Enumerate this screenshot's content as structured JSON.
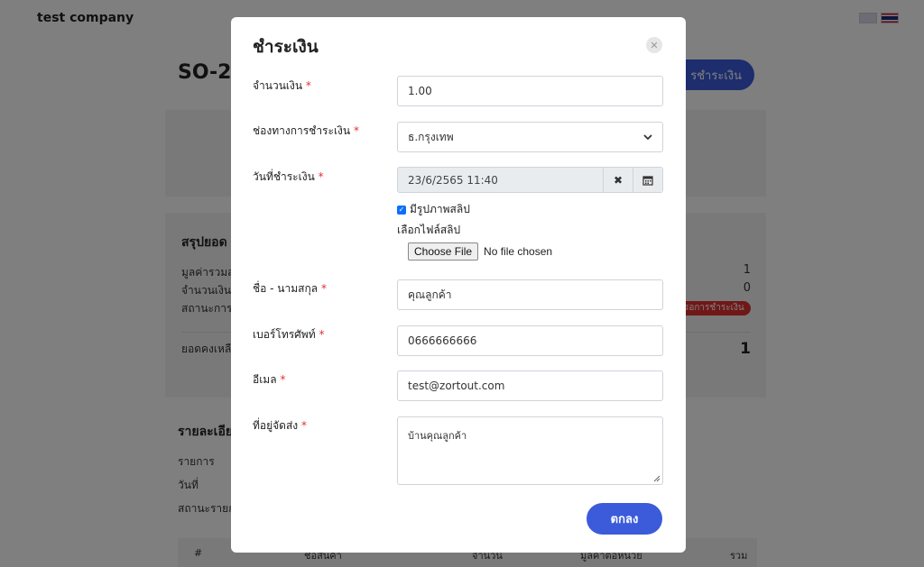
{
  "background": {
    "company_name": "test company",
    "order_title": "SO-2",
    "pay_button_label": "รชำระเงิน",
    "summary": {
      "title": "สรุปยอด",
      "rows": [
        {
          "label": "มูลค่ารวมส",
          "value": "1"
        },
        {
          "label": "จำนวนเงินที",
          "value": "0"
        },
        {
          "label": "สถานะการ",
          "value": ""
        }
      ],
      "status_badge": "รอการชำระเงิน",
      "balance_label": "ยอดคงเหลื",
      "balance_value": "1"
    },
    "details": {
      "title": "รายละเอีย",
      "rows": [
        "รายการ",
        "วันที่",
        "สถานะรายก"
      ]
    },
    "table_headers": [
      "#",
      "ชื่อสินค้า",
      "จำนวน",
      "มูลค่าต่อหน่วย",
      "รวม"
    ]
  },
  "modal": {
    "title": "ชำระเงิน",
    "close_icon": "close-icon",
    "amount": {
      "label": "จำนวนเงิน",
      "value": "1.00"
    },
    "channel": {
      "label": "ช่องทางการชำระเงิน",
      "value": "ธ.กรุงเทพ"
    },
    "payment_date": {
      "label": "วันที่ชำระเงิน",
      "value": "23/6/2565 11:40"
    },
    "has_slip": {
      "label": "มีรูปภาพสลิป",
      "checked": true
    },
    "choose_slip_label": "เลือกไฟล์สลิป",
    "file_input": {
      "button": "Choose File",
      "status": "No file chosen"
    },
    "name": {
      "label": "ชื่อ - นามสกุล",
      "value": "คุณลูกค้า"
    },
    "phone": {
      "label": "เบอร์โทรศัพท์",
      "value": "0666666666"
    },
    "email": {
      "label": "อีเมล",
      "value": "test@zortout.com"
    },
    "address": {
      "label": "ที่อยู่จัดส่ง",
      "value": "บ้านคุณลูกค้า"
    },
    "required_mark": "*",
    "ok_button": "ตกลง"
  },
  "colors": {
    "primary": "#3b5bdb",
    "required": "#e03131",
    "overlay": "rgba(0,0,0,0.5)"
  }
}
